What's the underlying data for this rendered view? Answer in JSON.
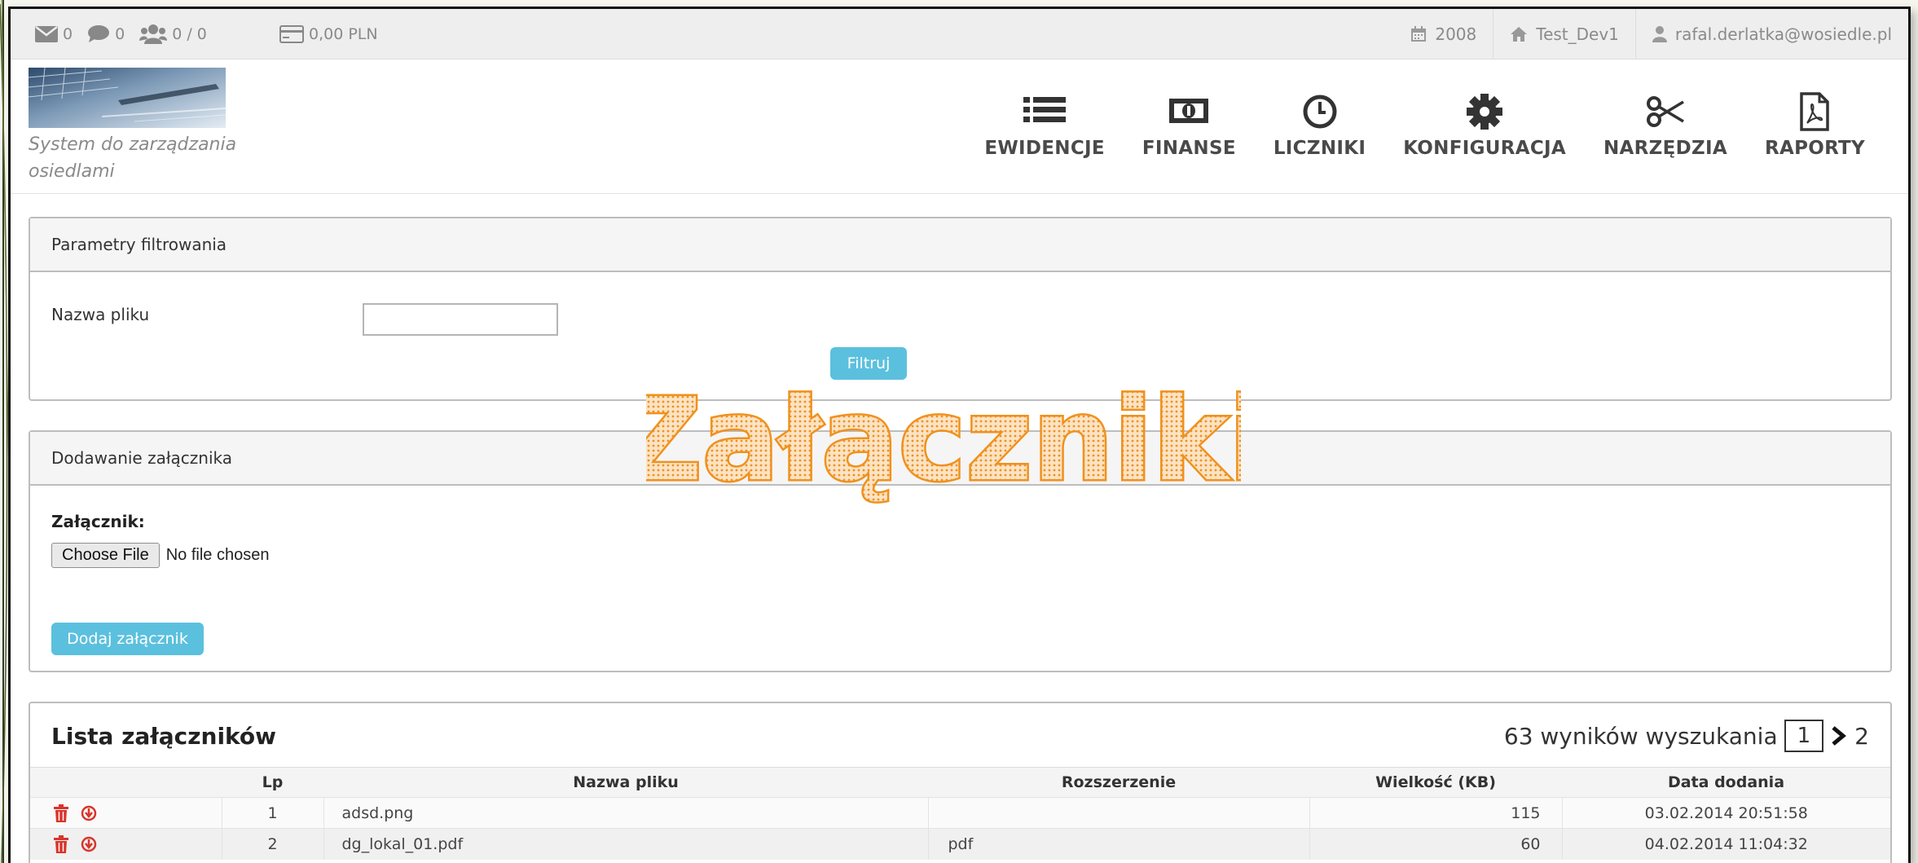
{
  "topbar": {
    "messages_count": "0",
    "comments_count": "0",
    "users_count": "0 / 0",
    "balance": "0,00 PLN",
    "year": "2008",
    "community": "Test_Dev1",
    "user_email": "rafal.derlatka@wosiedle.pl"
  },
  "header": {
    "logo_text": "System do zarządzania osiedlami",
    "nav": [
      {
        "label": "EWIDENCJE",
        "icon": "list-icon"
      },
      {
        "label": "FINANSE",
        "icon": "money-icon"
      },
      {
        "label": "LICZNIKI",
        "icon": "clock-icon"
      },
      {
        "label": "KONFIGURACJA",
        "icon": "gear-icon"
      },
      {
        "label": "NARZĘDZIA",
        "icon": "scissors-icon"
      },
      {
        "label": "RAPORTY",
        "icon": "pdf-file-icon"
      }
    ]
  },
  "filter": {
    "title": "Parametry filtrowania",
    "filename_label": "Nazwa pliku",
    "filename_value": "",
    "filter_button": "Filtruj"
  },
  "upload": {
    "title": "Dodawanie załącznika",
    "attachment_label": "Załącznik:",
    "choose_file": "Choose File",
    "no_file": "No file chosen",
    "add_button": "Dodaj załącznik"
  },
  "list": {
    "title": "Lista załączników",
    "results_text": "63 wyników wyszukania",
    "current_page": "1",
    "next_page": "2",
    "columns": [
      "Lp",
      "Nazwa pliku",
      "Rozszerzenie",
      "Wielkość (KB)",
      "Data dodania"
    ],
    "rows": [
      {
        "lp": "1",
        "name": "adsd.png",
        "ext": "",
        "size": "115",
        "date": "03.02.2014 20:51:58"
      },
      {
        "lp": "2",
        "name": "dg_lokal_01.pdf",
        "ext": "pdf",
        "size": "60",
        "date": "04.02.2014 11:04:32"
      }
    ]
  },
  "overlay_title": "Załączniki",
  "colors": {
    "accent": "#5bc0de",
    "delete": "#d9342b",
    "overlay": "#f0911d"
  }
}
